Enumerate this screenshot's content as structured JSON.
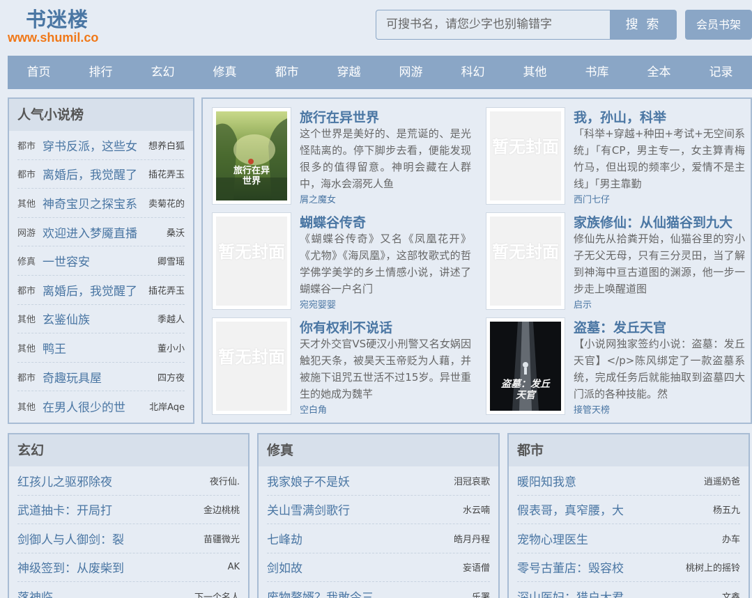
{
  "header": {
    "site_title": "书迷楼",
    "site_url": "www.shumil.co",
    "search_placeholder": "可搜书名，请您少字也别输错字",
    "search_button": "搜 索",
    "member_button": "会员书架"
  },
  "nav": [
    "首页",
    "排行",
    "玄幻",
    "修真",
    "都市",
    "穿越",
    "网游",
    "科幻",
    "其他",
    "书库",
    "全本",
    "记录"
  ],
  "popular": {
    "title": "人气小说榜",
    "items": [
      {
        "cat": "都市",
        "title": "穿书反派，这些女",
        "author": "想养白狐"
      },
      {
        "cat": "都市",
        "title": "离婚后，我觉醒了",
        "author": "插花弄玉"
      },
      {
        "cat": "其他",
        "title": "神奇宝贝之探宝系",
        "author": "卖菊花的"
      },
      {
        "cat": "网游",
        "title": "欢迎进入梦魇直播",
        "author": "桑沃"
      },
      {
        "cat": "修真",
        "title": "一世容安",
        "author": "卿雪瑶"
      },
      {
        "cat": "都市",
        "title": "离婚后，我觉醒了",
        "author": "插花弄玉"
      },
      {
        "cat": "其他",
        "title": "玄鉴仙族",
        "author": "季越人"
      },
      {
        "cat": "其他",
        "title": "鸭王",
        "author": "董小小"
      },
      {
        "cat": "都市",
        "title": "奇趣玩具屋",
        "author": "四方夜"
      },
      {
        "cat": "其他",
        "title": "在男人很少的世",
        "author": "北岸Aqe"
      }
    ]
  },
  "featured": [
    {
      "title": "旅行在异世界",
      "desc": "这个世界是美好的、是荒诞的、是光怪陆离的。停下脚步去看，便能发现很多的值得留意。神明会藏在人群中，海水会溺死人鱼",
      "author": "屑之魔女",
      "cover": "art",
      "cover_text": "旅行在异世界"
    },
    {
      "title": "我，孙山，科举",
      "desc": "「科举+穿越+种田+考试+无空间系统」「有CP，男主专一，女主算青梅竹马，但出现的频率少，爱情不是主线」「男主靠勤",
      "author": "西门七仔",
      "cover": "none",
      "cover_text": "暂无封面"
    },
    {
      "title": "蝴蝶谷传奇",
      "desc": "《蝴蝶谷传奇》又名《凤凰花开》《尤物》《海凤凰》，这部牧歌式的哲学佛学美学的乡土情感小说，讲述了蝴蝶谷一户名门",
      "author": "宛宛婴婴",
      "cover": "none",
      "cover_text": "暂无封面"
    },
    {
      "title": "家族修仙：从仙猫谷到九大",
      "desc": "修仙先从拾粪开始，仙猫谷里的穷小子无父无母，只有三分灵田，当了解到神海中亘古道图的渊源，他一步一步走上唤醒道图",
      "author": "启示",
      "cover": "none",
      "cover_text": "暂无封面"
    },
    {
      "title": "你有权利不说话",
      "desc": "天才外交官VS硬汉小刑警又名女娲因触犯天条，被昊天玉帝贬为人藉，并被施下诅咒五世活不过15岁。异世重生的她成为魏芊",
      "author": "空白角",
      "cover": "none",
      "cover_text": "暂无封面"
    },
    {
      "title": "盗墓：发丘天官",
      "desc": "【小说网独家签约小说：盗墓：发丘天官】</p>陈风绑定了一款盗墓系统，完成任务后就能抽取到盗墓四大门派的各种技能。然",
      "author": "接管天榜",
      "cover": "dark",
      "cover_text": "盗墓：发丘天官"
    }
  ],
  "categories": [
    {
      "title": "玄幻",
      "items": [
        {
          "title": "红孩儿之驱邪除夜",
          "author": "夜行仙."
        },
        {
          "title": "武道抽卡：开局打",
          "author": "金边桃桃"
        },
        {
          "title": "剑御人与人御剑：裂",
          "author": "苗疆微光"
        },
        {
          "title": "神级签到：从废柴到",
          "author": "AK"
        },
        {
          "title": "落神临",
          "author": "下一个名人"
        }
      ]
    },
    {
      "title": "修真",
      "items": [
        {
          "title": "我家娘子不是妖",
          "author": "泪冠哀歌"
        },
        {
          "title": "关山雪满剑歌行",
          "author": "水云喃"
        },
        {
          "title": "七峰劫",
          "author": "皓月丹程"
        },
        {
          "title": "剑如故",
          "author": "妄语僧"
        },
        {
          "title": "废物赘婿？我敢今三",
          "author": "乐署"
        }
      ]
    },
    {
      "title": "都市",
      "items": [
        {
          "title": "暖阳知我意",
          "author": "逍遥奶爸"
        },
        {
          "title": "假表哥，真窄腰，大",
          "author": "杨五九"
        },
        {
          "title": "宠物心理医生",
          "author": "办车"
        },
        {
          "title": "零号古董店：毁容校",
          "author": "桃树上的摇铃"
        },
        {
          "title": "深山医妇：猎户大君",
          "author": "文鑫"
        }
      ]
    }
  ]
}
